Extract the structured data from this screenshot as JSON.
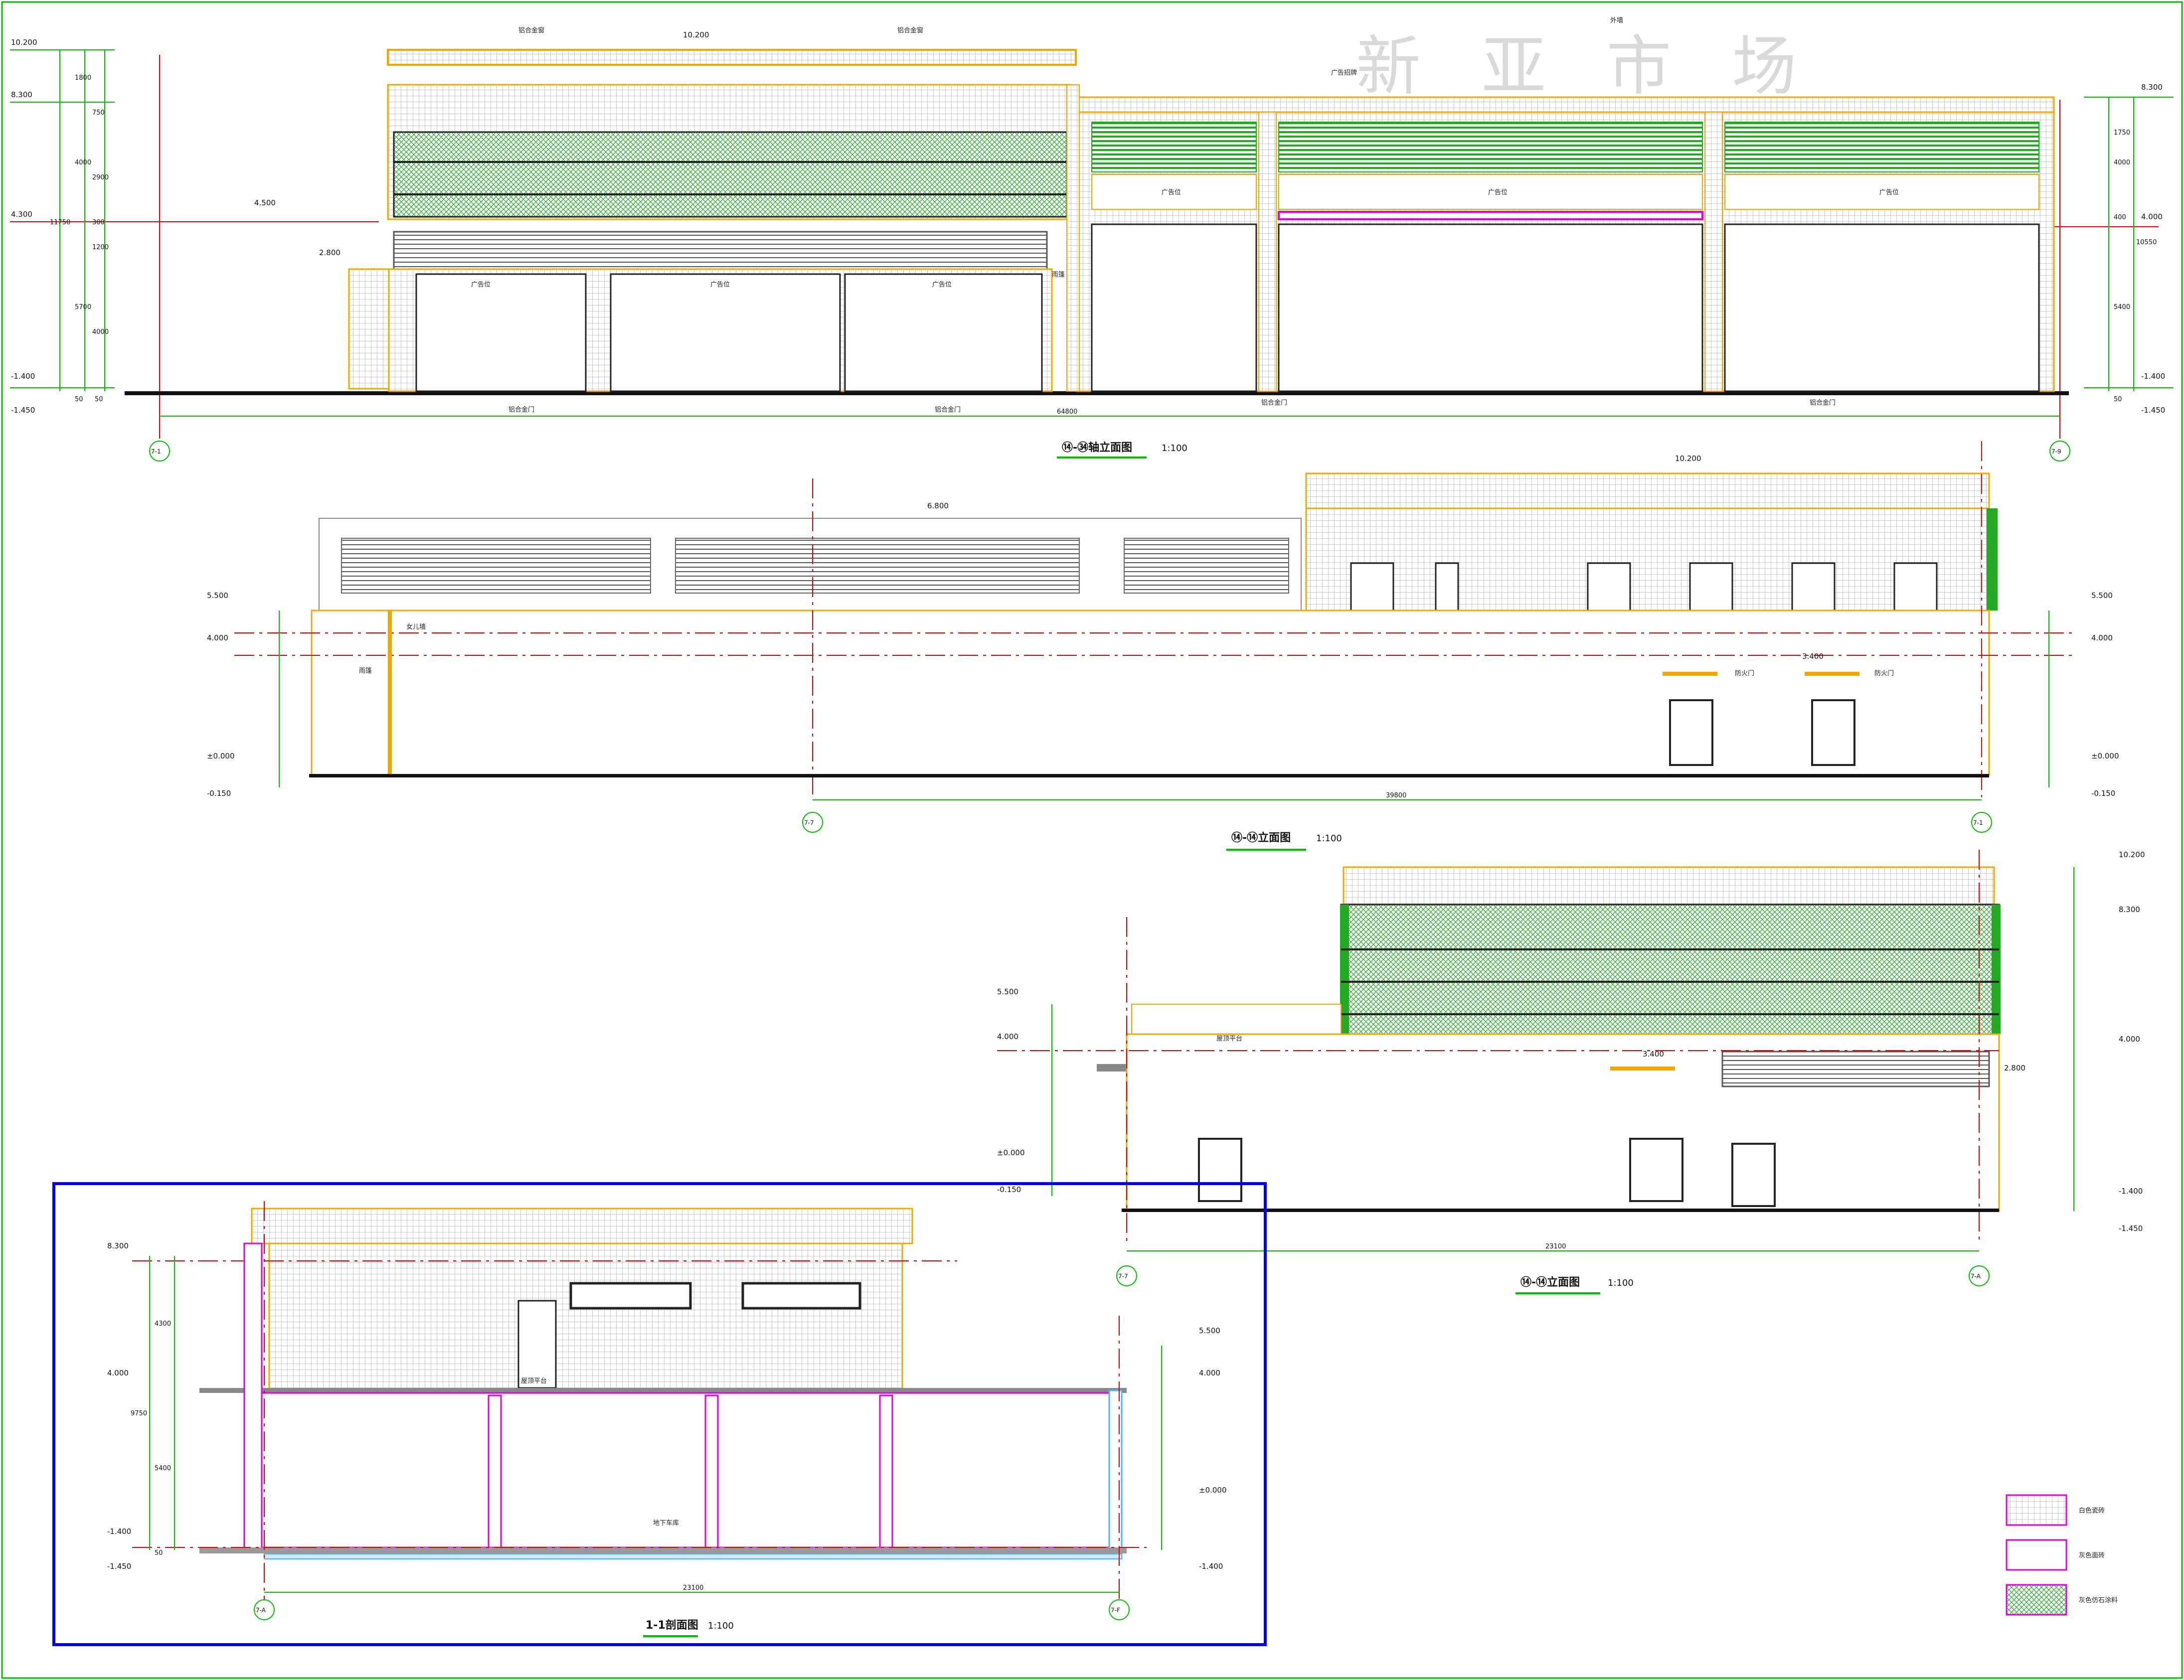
{
  "brand_sign": "新 亚 市 场",
  "palette": {
    "orange": "#f0a800",
    "green": "#22aa22",
    "dimension_green": "#00c000",
    "red_axis": "#e00000",
    "magenta": "#e000e0",
    "frame_blue": "#0000ee",
    "tile_grid": "#9a9a9a",
    "glass_dark": "#222222",
    "cyan": "#40b8ff"
  },
  "elevation_1": {
    "title": "⑭-㉞轴立面图",
    "scale": "1:100",
    "grid_left": "7-1",
    "grid_right": "7-9",
    "overall_dim": "64800",
    "levels_left": [
      "10.200",
      "8.300",
      "4.300",
      "2.800",
      "-1.400",
      "-1.450"
    ],
    "levels_right": [
      "8.300",
      "4.000",
      "-1.400",
      "-1.450"
    ],
    "mid_levels": [
      "10.200",
      "4.500"
    ],
    "dims_left": [
      "1800",
      "750",
      "4000",
      "11750",
      "5700",
      "2900",
      "300",
      "1200",
      "4000",
      "50",
      "50"
    ],
    "dims_right": [
      "1750",
      "4000",
      "400",
      "10550",
      "5400",
      "50"
    ],
    "sign_labels": [
      "广告位",
      "广告位",
      "广告位",
      "广告位",
      "广告位",
      "广告位"
    ],
    "notes": [
      "铝合金窗",
      "铝合金窗",
      "铝合金门",
      "铝合金门",
      "铝合金门",
      "铝合金门",
      "广告招牌",
      "外墙",
      "雨篷"
    ]
  },
  "elevation_2": {
    "title": "⑭-⑭立面图",
    "scale": "1:100",
    "grid_left": "7-7",
    "grid_right": "7-1",
    "overall_dim": "39800",
    "levels_left": [
      "5.500",
      "4.000",
      "±0.000",
      "-0.150"
    ],
    "levels_right": [
      "5.500",
      "4.000",
      "±0.000",
      "-0.150"
    ],
    "mid_levels": [
      "10.200",
      "6.800",
      "3.400"
    ],
    "notes": [
      "女儿墙",
      "雨篷",
      "防火门",
      "防火门"
    ]
  },
  "elevation_3": {
    "title": "⑭-⑭立面图",
    "scale": "1:100",
    "grid_left": "7-7",
    "grid_right": "7-A",
    "overall_dim": "23100",
    "levels_left": [
      "5.500",
      "4.000",
      "±0.000",
      "-0.150"
    ],
    "levels_right": [
      "10.200",
      "8.300",
      "4.000",
      "2.800",
      "-1.400",
      "-1.450"
    ],
    "mid_levels": [
      "3.400"
    ],
    "notes": [
      "屋顶平台"
    ]
  },
  "section_1": {
    "title": "1-1剖面图",
    "scale": "1:100",
    "grid_left": "7-A",
    "grid_right": "7-F",
    "overall_dim": "23100",
    "levels_left": [
      "8.300",
      "4.000",
      "-1.400",
      "-1.450"
    ],
    "levels_right": [
      "5.500",
      "4.000",
      "±0.000",
      "-1.400"
    ],
    "dims_left": [
      "4300",
      "9750",
      "5400",
      "50"
    ],
    "notes": [
      "屋顶平台",
      "地下车库"
    ]
  },
  "legend": [
    {
      "label": "白色瓷砖"
    },
    {
      "label": "灰色面砖"
    },
    {
      "label": "灰色仿石涂料"
    }
  ]
}
